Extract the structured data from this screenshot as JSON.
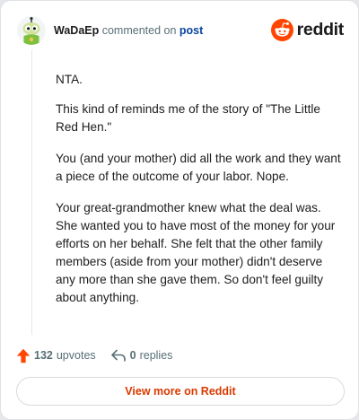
{
  "header": {
    "username": "WaDaEp",
    "action": "commented on",
    "link": "post",
    "brand": "reddit"
  },
  "comment": {
    "paragraphs": [
      "NTA.",
      "This kind of reminds me of the story of \"The Little Red Hen.\"",
      "You (and your mother) did all the work and they want a piece of the outcome of your labor. Nope.",
      "Your great-grandmother knew what the deal was. She wanted you to have most of the money for your efforts on her behalf. She felt that the other family members (aside from your mother) didn't deserve any more than she gave them. So don't feel guilty about anything."
    ]
  },
  "footer": {
    "upvote_count": "132",
    "upvote_label": "upvotes",
    "reply_count": "0",
    "reply_label": "replies"
  },
  "cta": {
    "label": "View more on Reddit"
  },
  "colors": {
    "brand_orange": "#ff4500",
    "cta_text": "#d93a00",
    "link_blue": "#0a449b",
    "muted": "#576f76"
  },
  "icons": {
    "avatar": "snoo-avatar-icon",
    "logo": "reddit-logo-icon",
    "upvote": "upvote-arrow-icon",
    "reply": "reply-arrow-icon"
  }
}
